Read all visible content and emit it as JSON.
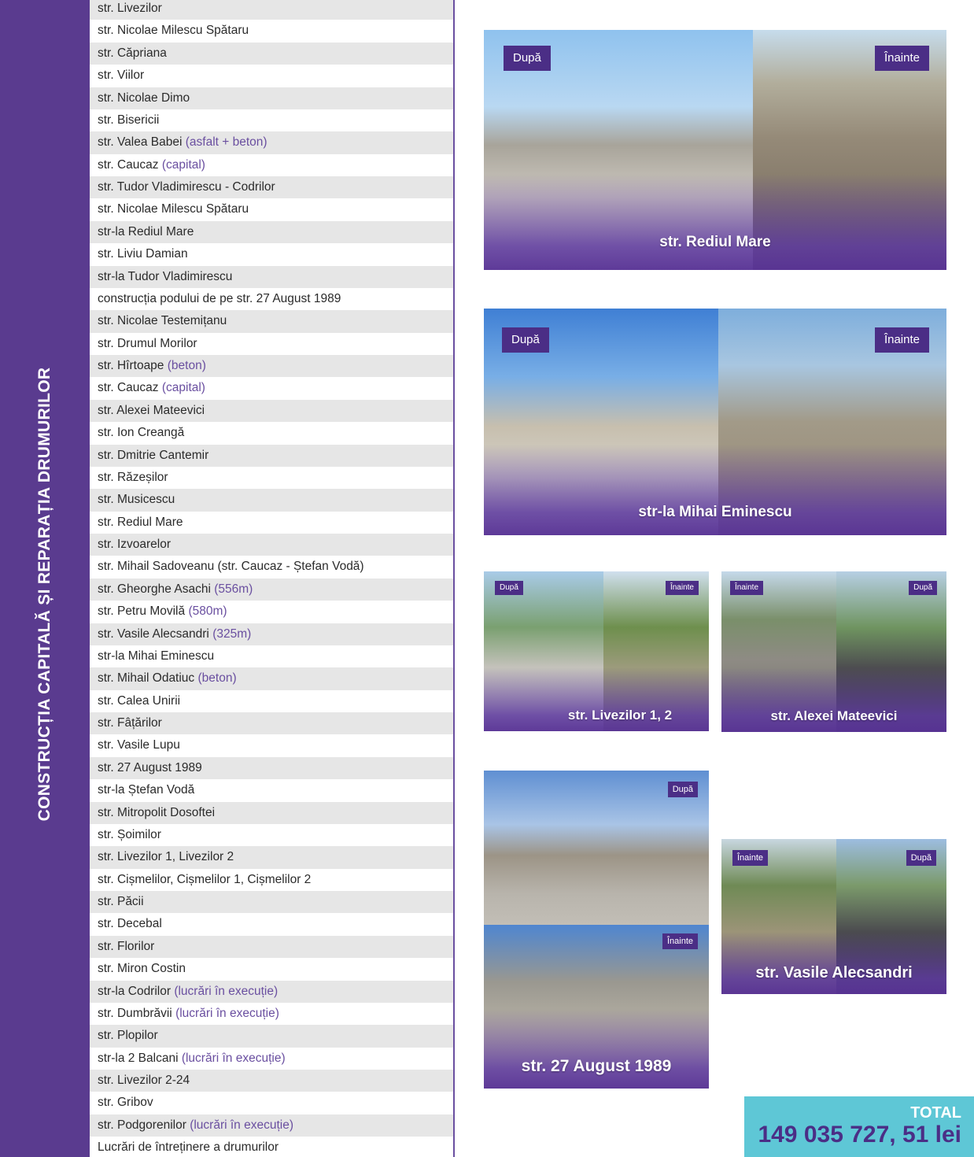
{
  "side_title": "CONSTRUCȚIA CAPITALĂ ȘI REPARAȚIA DRUMURILOR",
  "streets": [
    {
      "name": "str. Livezilor",
      "note": ""
    },
    {
      "name": "str. Nicolae Milescu Spătaru",
      "note": ""
    },
    {
      "name": "str. Căpriana",
      "note": ""
    },
    {
      "name": "str. Viilor",
      "note": ""
    },
    {
      "name": "str. Nicolae Dimo",
      "note": ""
    },
    {
      "name": "str. Bisericii",
      "note": ""
    },
    {
      "name": "str. Valea Babei",
      "note": "(asfalt + beton)"
    },
    {
      "name": "str. Caucaz",
      "note": "(capital)"
    },
    {
      "name": "str. Tudor Vladimirescu - Codrilor",
      "note": ""
    },
    {
      "name": "str. Nicolae Milescu Spătaru",
      "note": ""
    },
    {
      "name": "str-la Rediul Mare",
      "note": ""
    },
    {
      "name": "str. Liviu Damian",
      "note": ""
    },
    {
      "name": "str-la Tudor Vladimirescu",
      "note": ""
    },
    {
      "name": "construcția podului de pe str. 27 August 1989",
      "note": ""
    },
    {
      "name": "str. Nicolae Testemițanu",
      "note": ""
    },
    {
      "name": "str. Drumul Morilor",
      "note": ""
    },
    {
      "name": "str. Hîrtoape",
      "note": "(beton)"
    },
    {
      "name": "str. Caucaz",
      "note": "(capital)"
    },
    {
      "name": "str. Alexei Mateevici",
      "note": ""
    },
    {
      "name": "str. Ion Creangă",
      "note": ""
    },
    {
      "name": "str. Dmitrie Cantemir",
      "note": ""
    },
    {
      "name": "str. Răzeșilor",
      "note": ""
    },
    {
      "name": "str. Musicescu",
      "note": ""
    },
    {
      "name": "str. Rediul Mare",
      "note": ""
    },
    {
      "name": "str. Izvoarelor",
      "note": ""
    },
    {
      "name": "str. Mihail Sadoveanu (str. Caucaz - Ștefan Vodă)",
      "note": ""
    },
    {
      "name": "str. Gheorghe Asachi",
      "note": "(556m)"
    },
    {
      "name": "str. Petru Movilă",
      "note": "(580m)"
    },
    {
      "name": "str. Vasile Alecsandri",
      "note": "(325m)"
    },
    {
      "name": "str-la Mihai Eminescu",
      "note": ""
    },
    {
      "name": "str. Mihail Odatiuc",
      "note": "(beton)"
    },
    {
      "name": "str. Calea Unirii",
      "note": ""
    },
    {
      "name": "str. Fâțărilor",
      "note": ""
    },
    {
      "name": "str. Vasile Lupu",
      "note": ""
    },
    {
      "name": "str. 27 August 1989",
      "note": ""
    },
    {
      "name": "str-la Ștefan Vodă",
      "note": ""
    },
    {
      "name": "str. Mitropolit Dosoftei",
      "note": ""
    },
    {
      "name": "str. Șoimilor",
      "note": ""
    },
    {
      "name": "str. Livezilor 1, Livezilor 2",
      "note": ""
    },
    {
      "name": "str. Cișmelilor, Cișmelilor 1, Cișmelilor 2",
      "note": ""
    },
    {
      "name": "str. Păcii",
      "note": ""
    },
    {
      "name": "str. Decebal",
      "note": ""
    },
    {
      "name": "str. Florilor",
      "note": ""
    },
    {
      "name": "str. Miron Costin",
      "note": ""
    },
    {
      "name": "str-la Codrilor",
      "note": "(lucrări în execuție)"
    },
    {
      "name": "str. Dumbrăvii",
      "note": "(lucrări în execuție)"
    },
    {
      "name": "str. Plopilor",
      "note": ""
    },
    {
      "name": "str-la 2 Balcani",
      "note": "(lucrări în execuție)"
    },
    {
      "name": "str. Livezilor 2-24",
      "note": ""
    },
    {
      "name": "str. Gribov",
      "note": ""
    },
    {
      "name": "str. Podgorenilor",
      "note": "(lucrări în execuție)"
    },
    {
      "name": "Lucrări de întreținere a drumurilor",
      "note": ""
    }
  ],
  "cards": {
    "rediul_mare": {
      "caption": "str.  Rediul Mare",
      "tag_after": "După",
      "tag_before": "Înainte"
    },
    "mihai_eminescu": {
      "caption": "str-la Mihai Eminescu",
      "tag_after": "După",
      "tag_before": "Înainte"
    },
    "livezilor": {
      "caption": "str. Livezilor 1, 2",
      "tag_after": "După",
      "tag_before": "Înainte"
    },
    "alexei_mateevici": {
      "caption": "str. Alexei Mateevici",
      "tag_after": "După",
      "tag_before": "Înainte"
    },
    "august_1989": {
      "caption": "str. 27 August 1989",
      "tag_after": "După",
      "tag_before": "Înainte"
    },
    "vasile_alecsandri": {
      "caption": "str. Vasile Alecsandri",
      "tag_after": "După",
      "tag_before": "Înainte"
    }
  },
  "total": {
    "label": "TOTAL",
    "value": "149 035 727, 51 lei"
  },
  "colors": {
    "purple": "#5a3b8f",
    "accent_purple": "#6a4fa0",
    "tag_purple": "#4b2e86",
    "total_teal": "#5ec7d6",
    "row_gray": "#e6e6e6"
  }
}
